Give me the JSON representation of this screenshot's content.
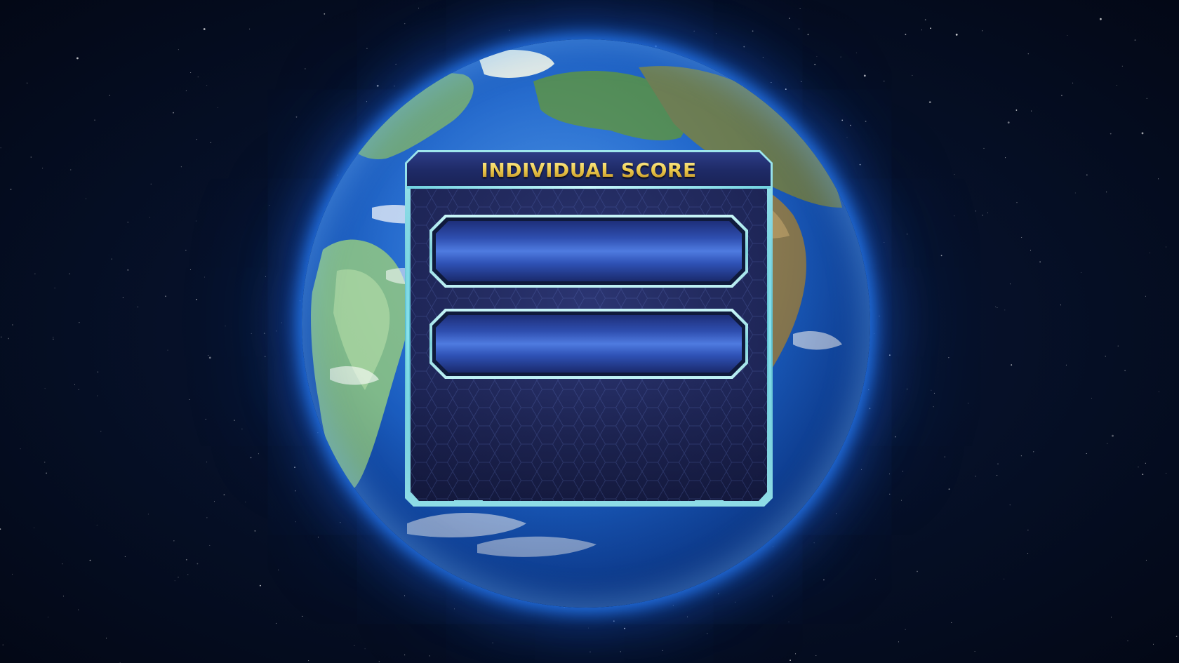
{
  "panel": {
    "title": "INDIVIDUAL SCORE",
    "score_slots": [
      {
        "value": ""
      },
      {
        "value": ""
      }
    ]
  },
  "colors": {
    "title_gold": "#f0cf52",
    "frame_cyan": "#8fdce6",
    "slot_blue": "#4f7be0",
    "panel_navy": "#222a5e",
    "earth_glow": "#2882ff",
    "space": "#040a1c"
  },
  "background": {
    "scene": "earth-from-space",
    "icon": "earth-globe-icon"
  }
}
